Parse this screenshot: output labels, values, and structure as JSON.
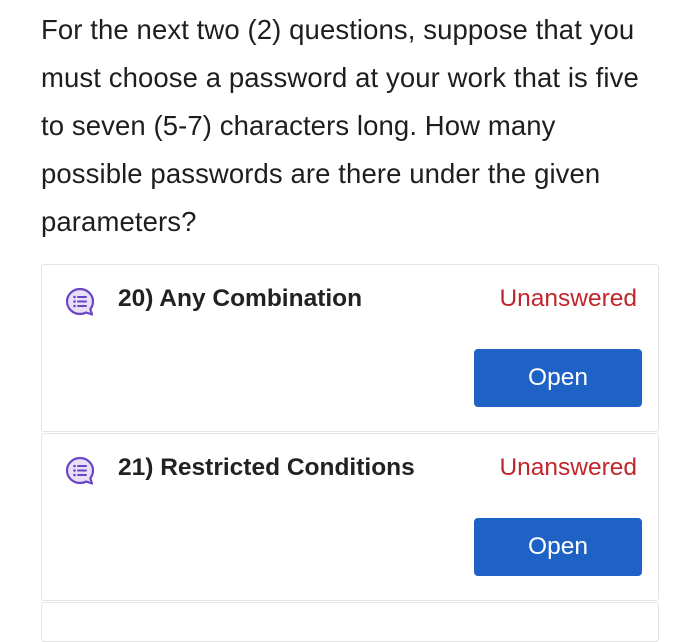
{
  "prompt": {
    "lines": [
      "For the next two (2) questions, suppose that you",
      "must choose a password at your work that is five",
      "to seven (5-7) characters long. How many",
      "possible passwords are there under the given",
      "parameters?"
    ]
  },
  "questions": [
    {
      "title": "20) Any Combination",
      "status": "Unanswered",
      "button_label": "Open",
      "icon": "question-list-icon"
    },
    {
      "title": "21) Restricted Conditions",
      "status": "Unanswered",
      "button_label": "Open",
      "icon": "question-list-icon"
    }
  ],
  "colors": {
    "status_unanswered": "#c0262d",
    "button_primary": "#1e62c6",
    "icon_fill": "#e7e0f7",
    "icon_stroke": "#6a45c5"
  }
}
